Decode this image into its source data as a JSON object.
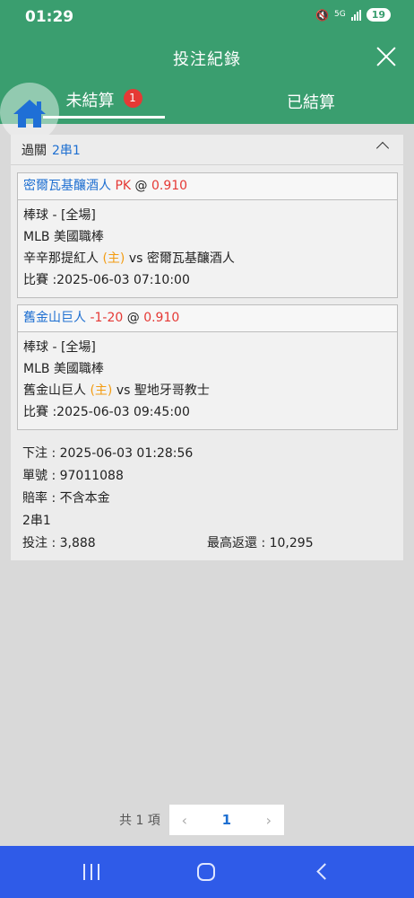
{
  "status_bar": {
    "time": "01:29",
    "mute_glyph": "🔇",
    "network": "5G",
    "battery": "19"
  },
  "header": {
    "title": "投注紀錄",
    "tabs": {
      "open_label": "未結算",
      "open_badge": "1",
      "settled_label": "已結算"
    }
  },
  "bet": {
    "head_label": "過關",
    "parlay_type": "2串1",
    "legs": [
      {
        "team": "密爾瓦基釀酒人",
        "handicap": "PK",
        "at": "@",
        "odds": "0.910",
        "sport": "棒球 - [全場]",
        "league": "MLB 美國職棒",
        "home_team": "辛辛那提紅人",
        "home_tag": "(主)",
        "vs": "vs",
        "away_team": "密爾瓦基釀酒人",
        "match_time": "比賽 :2025-06-03 07:10:00"
      },
      {
        "team": "舊金山巨人",
        "handicap": "-1-20",
        "at": "@",
        "odds": "0.910",
        "sport": "棒球 - [全場]",
        "league": "MLB 美國職棒",
        "home_team": "舊金山巨人",
        "home_tag": "(主)",
        "vs": "vs",
        "away_team": "聖地牙哥教士",
        "match_time": "比賽 :2025-06-03 09:45:00"
      }
    ],
    "placed": "下注 : 2025-06-03 01:28:56",
    "ticket": "單號 : 97011088",
    "odds_type": "賠率 : 不含本金",
    "combo": "2串1",
    "stake": "投注 : 3,888",
    "max_return": "最高返還 : 10,295"
  },
  "pagination": {
    "total": "共 1 項",
    "prev": "‹",
    "current": "1",
    "next": "›"
  },
  "colors": {
    "primary": "#3a9e6f",
    "link_blue": "#1e6fd1",
    "odds_red": "#e53935",
    "home_orange": "#f39c12",
    "nav_bar": "#2f5be8"
  }
}
